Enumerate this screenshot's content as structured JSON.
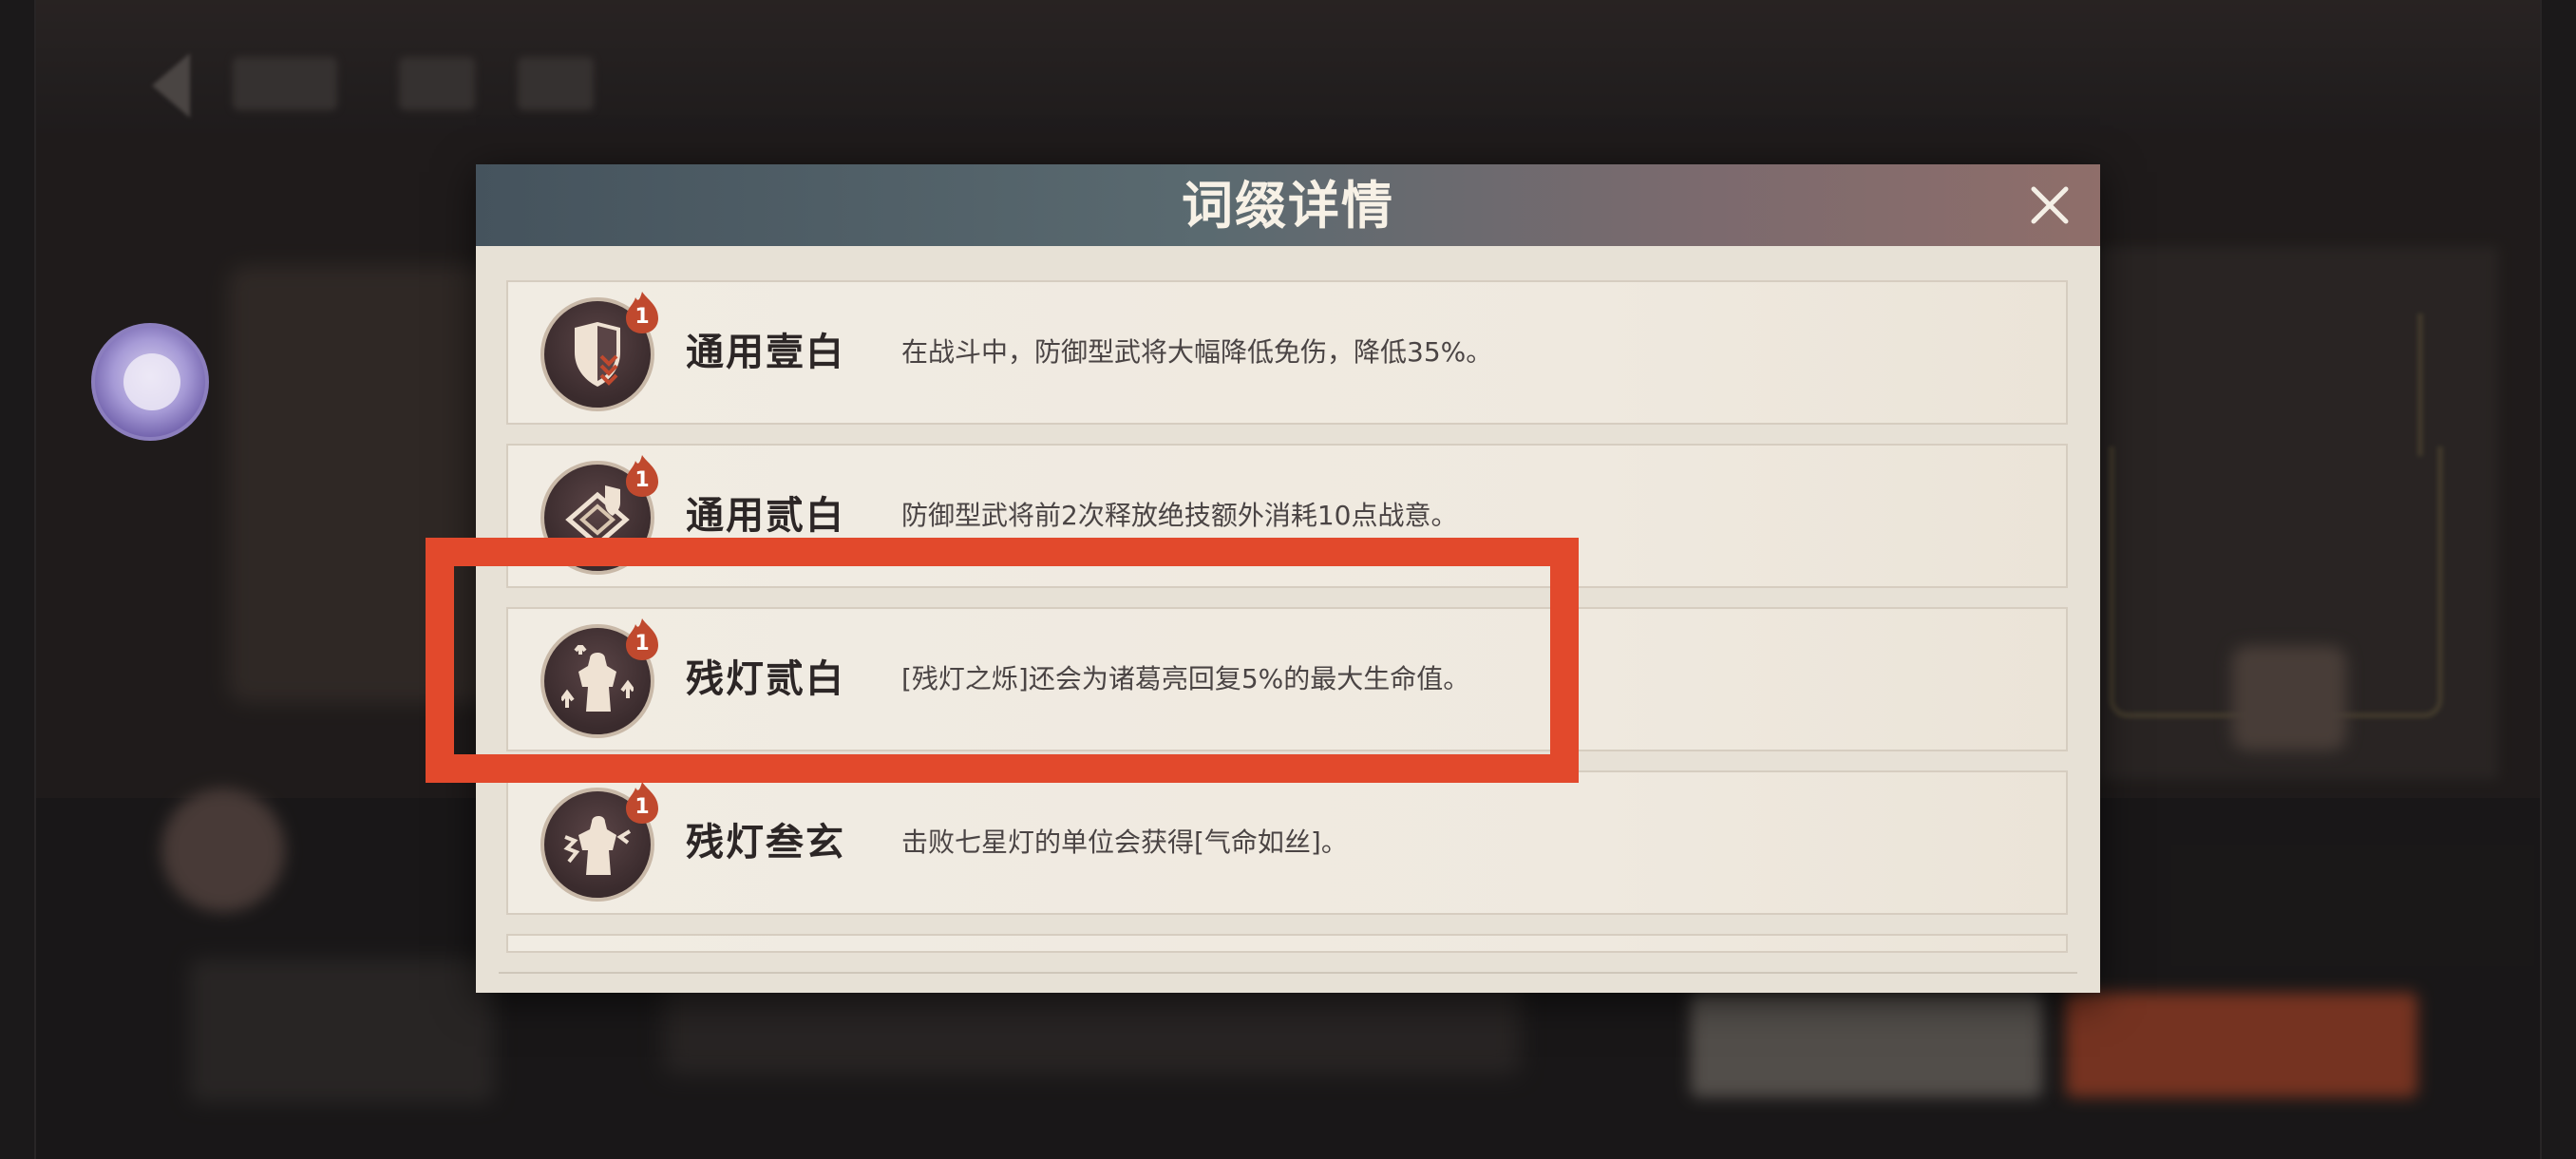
{
  "dialog": {
    "title": "词缀详情",
    "close_icon": "close-icon"
  },
  "entries": [
    {
      "name": "通用壹白",
      "desc": "在战斗中，防御型武将大幅降低免伤，降低35%。",
      "level": "1",
      "icon": "shield-down-icon"
    },
    {
      "name": "通用贰白",
      "desc": "防御型武将前2次释放绝技额外消耗10点战意。",
      "level": "1",
      "icon": "shield-skill-icon"
    },
    {
      "name": "残灯贰白",
      "desc": "[残灯之烁]还会为诸葛亮回复5%的最大生命值。",
      "level": "1",
      "icon": "heal-up-icon"
    },
    {
      "name": "残灯叁玄",
      "desc": "击败七星灯的单位会获得[气命如丝]。",
      "level": "1",
      "icon": "burst-icon"
    }
  ],
  "colors": {
    "highlight": "#e2492c",
    "badge": "#c0492e",
    "header_start": "#45535d",
    "header_end": "#8f6e6a"
  }
}
